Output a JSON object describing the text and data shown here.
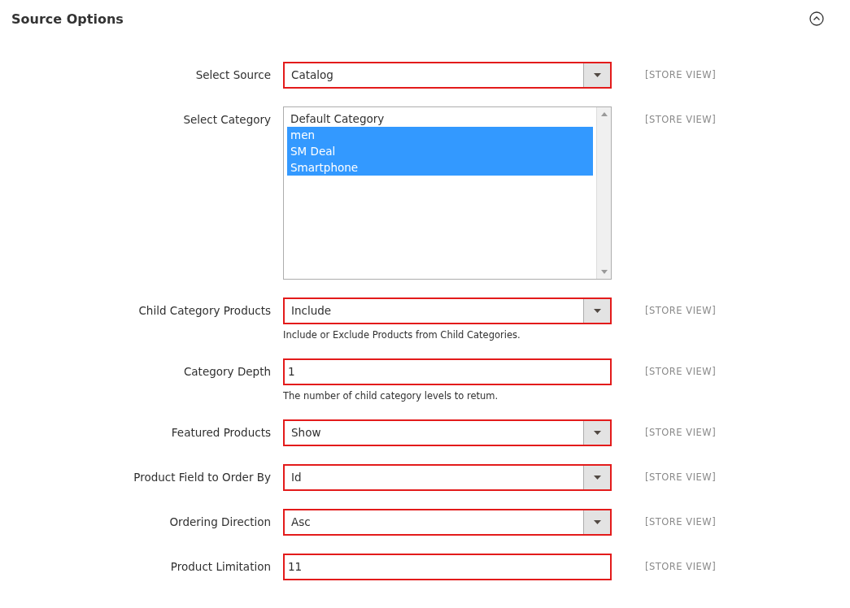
{
  "section": {
    "title": "Source Options",
    "expanded": true
  },
  "fields": [
    {
      "kind": "select",
      "label": "Select Source",
      "value": "Catalog",
      "scope": "[STORE VIEW]",
      "highlighted": true
    },
    {
      "kind": "multiselect",
      "label": "Select Category",
      "scope": "[STORE VIEW]",
      "highlighted": false,
      "options": [
        {
          "label": "Default Category",
          "selected": false
        },
        {
          "label": "men",
          "selected": true
        },
        {
          "label": "SM Deal",
          "selected": true
        },
        {
          "label": "Smartphone",
          "selected": true
        }
      ]
    },
    {
      "kind": "select",
      "label": "Child Category Products",
      "value": "Include",
      "scope": "[STORE VIEW]",
      "highlighted": true,
      "note": "Include or Exclude Products from Child Categories."
    },
    {
      "kind": "text",
      "label": "Category Depth",
      "value": "1",
      "scope": "[STORE VIEW]",
      "highlighted": true,
      "note": "The number of child category levels to retum."
    },
    {
      "kind": "select",
      "label": "Featured Products",
      "value": "Show",
      "scope": "[STORE VIEW]",
      "highlighted": true
    },
    {
      "kind": "select",
      "label": "Product Field to Order By",
      "value": "Id",
      "scope": "[STORE VIEW]",
      "highlighted": true
    },
    {
      "kind": "select",
      "label": "Ordering Direction",
      "value": "Asc",
      "scope": "[STORE VIEW]",
      "highlighted": true
    },
    {
      "kind": "text",
      "label": "Product Limitation",
      "value": "11",
      "scope": "[STORE VIEW]",
      "highlighted": true
    }
  ]
}
